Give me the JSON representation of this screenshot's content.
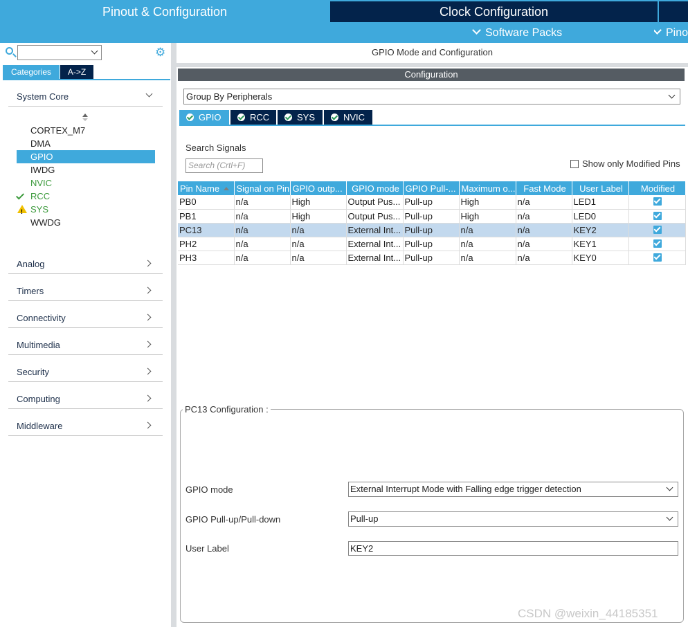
{
  "top_tabs": {
    "pinout": "Pinout & Configuration",
    "clock": "Clock Configuration"
  },
  "sub_menu": {
    "software_packs": "Software Packs",
    "pinout": "Pinout"
  },
  "left_panel": {
    "search_value": "",
    "tabs": {
      "categories": "Categories",
      "az": "A->Z"
    },
    "system_core_label": "System Core",
    "peripherals": [
      {
        "label": "CORTEX_M7",
        "status": "none"
      },
      {
        "label": "DMA",
        "status": "none"
      },
      {
        "label": "GPIO",
        "status": "selected"
      },
      {
        "label": "IWDG",
        "status": "none"
      },
      {
        "label": "NVIC",
        "status": "configured"
      },
      {
        "label": "RCC",
        "status": "ok"
      },
      {
        "label": "SYS",
        "status": "warning"
      },
      {
        "label": "WWDG",
        "status": "none"
      }
    ],
    "groups": [
      "Analog",
      "Timers",
      "Connectivity",
      "Multimedia",
      "Security",
      "Computing",
      "Middleware"
    ]
  },
  "right_panel": {
    "title": "GPIO Mode and Configuration",
    "config_header": "Configuration",
    "group_by": "Group By Peripherals",
    "tabs": [
      "GPIO",
      "RCC",
      "SYS",
      "NVIC"
    ],
    "search_label": "Search Signals",
    "search_placeholder": "Search (Crtl+F)",
    "show_modified_label": "Show only Modified Pins",
    "table": {
      "headers": [
        "Pin Name",
        "Signal on Pin",
        "GPIO outp...",
        "GPIO mode",
        "GPIO Pull-...",
        "Maximum o...",
        "Fast Mode",
        "User Label",
        "Modified"
      ],
      "rows": [
        [
          "PB0",
          "n/a",
          "High",
          "Output Pus...",
          "Pull-up",
          "High",
          "n/a",
          "LED1"
        ],
        [
          "PB1",
          "n/a",
          "High",
          "Output Pus...",
          "Pull-up",
          "High",
          "n/a",
          "LED0"
        ],
        [
          "PC13",
          "n/a",
          "n/a",
          "External Int...",
          "Pull-up",
          "n/a",
          "n/a",
          "KEY2"
        ],
        [
          "PH2",
          "n/a",
          "n/a",
          "External Int...",
          "Pull-up",
          "n/a",
          "n/a",
          "KEY1"
        ],
        [
          "PH3",
          "n/a",
          "n/a",
          "External Int...",
          "Pull-up",
          "n/a",
          "n/a",
          "KEY0"
        ]
      ]
    },
    "pin_config": {
      "legend": "PC13 Configuration :",
      "gpio_mode_label": "GPIO mode",
      "gpio_mode_value": "External Interrupt Mode with Falling edge trigger detection",
      "pull_label": "GPIO Pull-up/Pull-down",
      "pull_value": "Pull-up",
      "user_label_label": "User Label",
      "user_label_value": "KEY2"
    }
  },
  "watermark": "CSDN @weixin_44185351",
  "colors": {
    "accent": "#3fa9dc",
    "navy": "#03234b",
    "selected_row": "#c3d9ee",
    "ok_green": "#3c9a3c",
    "warning": "#f0c000"
  }
}
